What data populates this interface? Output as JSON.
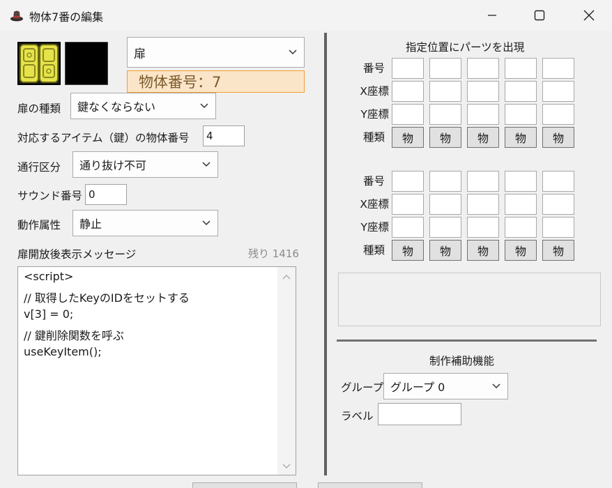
{
  "window": {
    "title": "物体7番の編集",
    "minimize_icon": "minimize-icon",
    "maximize_icon": "maximize-icon",
    "close_icon": "close-icon"
  },
  "object": {
    "category_selected": "扉",
    "number_label": "物体番号：7"
  },
  "fields": {
    "door_type_label": "扉の種類",
    "door_type_value": "鍵なくならない",
    "item_label": "対応するアイテム（鍵）の物体番号",
    "item_value": "4",
    "passage_label": "通行区分",
    "passage_value": "通り抜け不可",
    "sound_label": "サウンド番号",
    "sound_value": "0",
    "motion_label": "動作属性",
    "motion_value": "静止"
  },
  "message": {
    "label": "扉開放後表示メッセージ",
    "remaining": "残り 1416",
    "lines": [
      "<script>",
      "// 取得したKeyのIDをセットする",
      "v[3] = 0;",
      "// 鍵削除関数を呼ぶ",
      "useKeyItem();"
    ]
  },
  "parts": {
    "title": "指定位置にパーツを出現",
    "row_labels": [
      "番号",
      "X座標",
      "Y座標",
      "種類"
    ],
    "type_button": "物"
  },
  "assist": {
    "title": "制作補助機能",
    "group_label": "グループ",
    "group_value": "グループ 0",
    "label_label": "ラベル",
    "label_value": ""
  }
}
